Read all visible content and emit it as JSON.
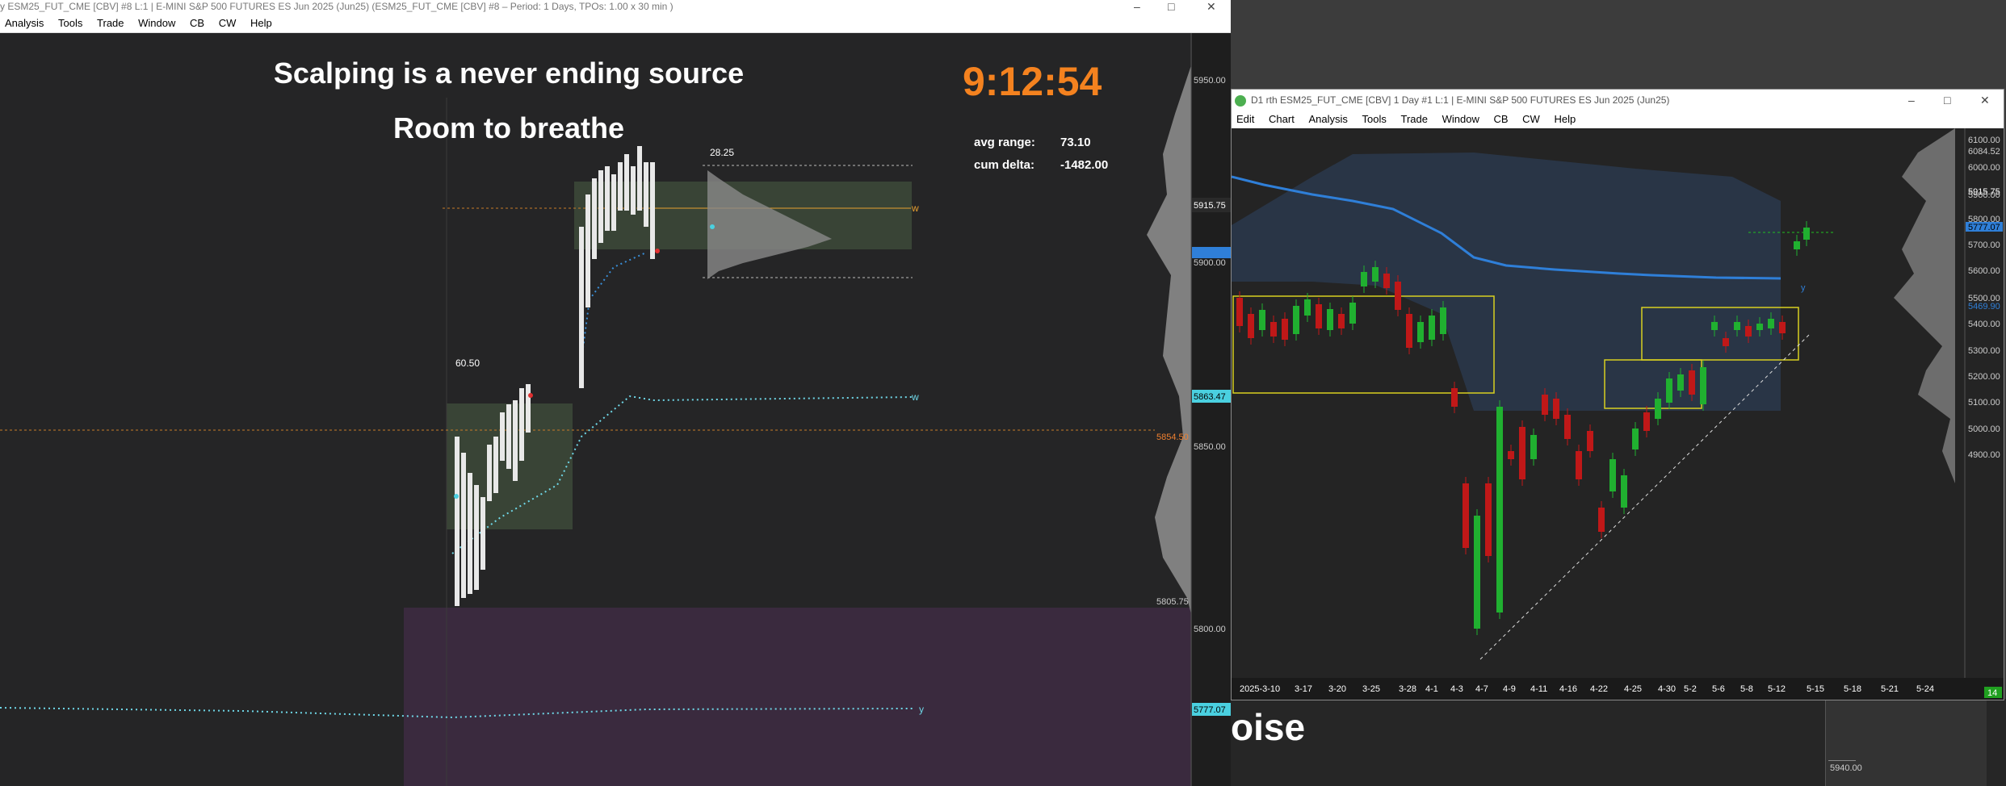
{
  "left_window": {
    "title": "y ESM25_FUT_CME [CBV] #8 L:1 | E-MINI S&P 500 FUTURES ES Jun 2025 (Jun25) (ESM25_FUT_CME [CBV] #8 – Period: 1 Days, TPOs: 1.00 x 30 min )",
    "menu": [
      "Analysis",
      "Tools",
      "Trade",
      "Window",
      "CB",
      "CW",
      "Help"
    ],
    "heading1": "Scalping is a never ending source",
    "heading2": "Room to breathe",
    "clock": "9:12:54",
    "avg_range_label": "avg range:",
    "avg_range_value": "73.10",
    "cum_delta_label": "cum delta:",
    "cum_delta_value": "-1482.00",
    "ann_6050": "60.50",
    "ann_2825": "28.25",
    "line_labels": {
      "w1": "w",
      "w2": "w",
      "y": "y"
    },
    "price_axis": [
      "5950.00",
      "5915.75",
      "5900.00",
      "5863.47",
      "5854.50",
      "5850.00",
      "5805.75",
      "5800.00",
      "5777.07"
    ],
    "colors": {
      "clock": "#f4821f",
      "orange_line": "#c87a28",
      "profile_fill": "#3d4a3a",
      "purple_zone": "#3a2a3e"
    }
  },
  "right_window": {
    "title": "D1 rth ESM25_FUT_CME [CBV]  1 Day  #1 L:1 | E-MINI S&P 500 FUTURES ES Jun 2025 (Jun25)",
    "menu": [
      "Edit",
      "Chart",
      "Analysis",
      "Tools",
      "Trade",
      "Window",
      "CB",
      "CW",
      "Help"
    ],
    "price_axis": [
      "6100.00",
      "6084.52",
      "6000.00",
      "5915.75",
      "5900.00",
      "5800.00",
      "5777.07",
      "5700.00",
      "5600.00",
      "5500.00",
      "5469.90",
      "5400.00",
      "5300.00",
      "5200.00",
      "5100.00",
      "5000.00",
      "4900.00"
    ],
    "date_axis": [
      "2025-3-10",
      "3-17",
      "3-20",
      "3-25",
      "3-28",
      "4-1",
      "4-3",
      "4-7",
      "4-9",
      "4-11",
      "4-16",
      "4-22",
      "4-25",
      "4-30",
      "5-2",
      "5-6",
      "5-8",
      "5-12",
      "5-15",
      "5-18",
      "5-21",
      "5-24"
    ],
    "y_label": "y",
    "corner_badge": "14"
  },
  "bottom": {
    "partial_text": "oise",
    "price": "5940.00"
  }
}
